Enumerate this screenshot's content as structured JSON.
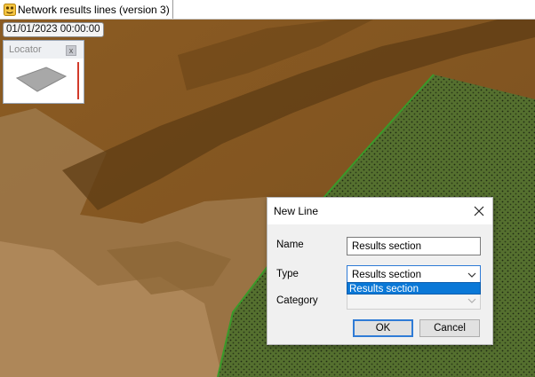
{
  "window": {
    "tab_title": "Network results lines (version 3)"
  },
  "map": {
    "timestamp": "01/01/2023 00:00:00"
  },
  "locator": {
    "title": "Locator",
    "close_glyph": "x"
  },
  "dialog": {
    "title": "New Line",
    "name_label": "Name",
    "name_value": "Results section",
    "type_label": "Type",
    "type_value": "Results section",
    "type_options": [
      "Results section"
    ],
    "category_label": "Category",
    "category_value": "",
    "ok_label": "OK",
    "cancel_label": "Cancel"
  },
  "icons": {
    "tab": "workspace-icon",
    "dialog_close": "close-icon",
    "dropdown": "chevron-down-icon"
  },
  "colors": {
    "terrain_dark": "#6e4a1e",
    "terrain_light": "#a98355",
    "mesh_green": "#4f6b2c",
    "selection_blue": "#0a78d7",
    "accent_border": "#2f7bd6"
  }
}
